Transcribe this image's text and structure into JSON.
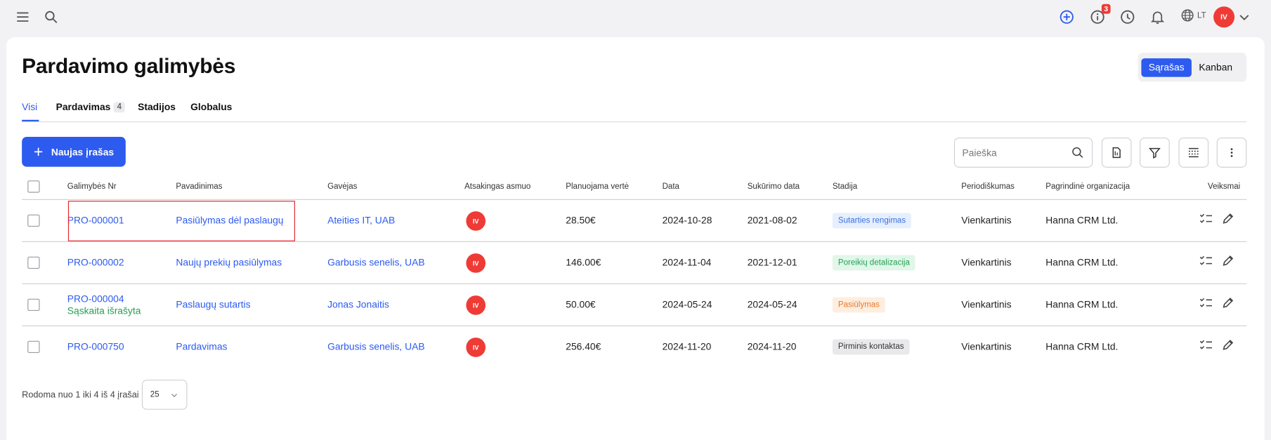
{
  "page": {
    "title": "Pardavimo galimybės"
  },
  "topbar": {
    "notification_count": "3",
    "language": "LT",
    "user_initials": "IV"
  },
  "view_switch": {
    "list_label": "Sąrašas",
    "kanban_label": "Kanban",
    "active": "list"
  },
  "tabs": [
    {
      "label": "Visi",
      "active": true
    },
    {
      "label": "Pardavimas",
      "count": "4"
    },
    {
      "label": "Stadijos"
    },
    {
      "label": "Globalus"
    }
  ],
  "toolbar": {
    "new_label": "Naujas įrašas",
    "search_placeholder": "Paieška"
  },
  "table": {
    "columns": [
      "Galimybės Nr",
      "Pavadinimas",
      "Gavėjas",
      "Atsakingas asmuo",
      "Planuojama vertė",
      "Data",
      "Sukūrimo data",
      "Stadija",
      "Periodiškumas",
      "Pagrindinė organizacija",
      "Veiksmai"
    ],
    "rows": [
      {
        "number": "PRO-000001",
        "sub_status": "",
        "name": "Pasiūlymas dėl paslaugų",
        "recipient": "Ateities IT, UAB",
        "responsible": "IV",
        "value": "28.50€",
        "date": "2024-10-28",
        "created": "2021-08-02",
        "stage": "Sutarties rengimas",
        "stage_bg": "#e6effd",
        "stage_color": "#3b6fe0",
        "periodicity": "Vienkartinis",
        "organization": "Hanna CRM Ltd."
      },
      {
        "number": "PRO-000002",
        "sub_status": "",
        "name": "Naujų prekių pasiūlymas",
        "recipient": "Garbusis senelis, UAB",
        "responsible": "IV",
        "value": "146.00€",
        "date": "2024-11-04",
        "created": "2021-12-01",
        "stage": "Poreikių detalizacija",
        "stage_bg": "#e2f6ea",
        "stage_color": "#24a052",
        "periodicity": "Vienkartinis",
        "organization": "Hanna CRM Ltd."
      },
      {
        "number": "PRO-000004",
        "sub_status": "Sąskaita išrašyta",
        "name": "Paslaugų sutartis",
        "recipient": "Jonas Jonaitis",
        "responsible": "IV",
        "value": "50.00€",
        "date": "2024-05-24",
        "created": "2024-05-24",
        "stage": "Pasiūlymas",
        "stage_bg": "#fdeedf",
        "stage_color": "#e8792a",
        "periodicity": "Vienkartinis",
        "organization": "Hanna CRM Ltd."
      },
      {
        "number": "PRO-000750",
        "sub_status": "",
        "name": "Pardavimas",
        "recipient": "Garbusis senelis, UAB",
        "responsible": "IV",
        "value": "256.40€",
        "date": "2024-11-20",
        "created": "2024-11-20",
        "stage": "Pirminis kontaktas",
        "stage_bg": "#e9e9eb",
        "stage_color": "#333333",
        "periodicity": "Vienkartinis",
        "organization": "Hanna CRM Ltd."
      }
    ]
  },
  "footer": {
    "summary": "Rodoma nuo 1 iki 4 iš 4 įrašai",
    "page_size": "25"
  },
  "colors": {
    "accent": "#2d5bf0",
    "danger": "#ef3b36",
    "success": "#24a052"
  }
}
